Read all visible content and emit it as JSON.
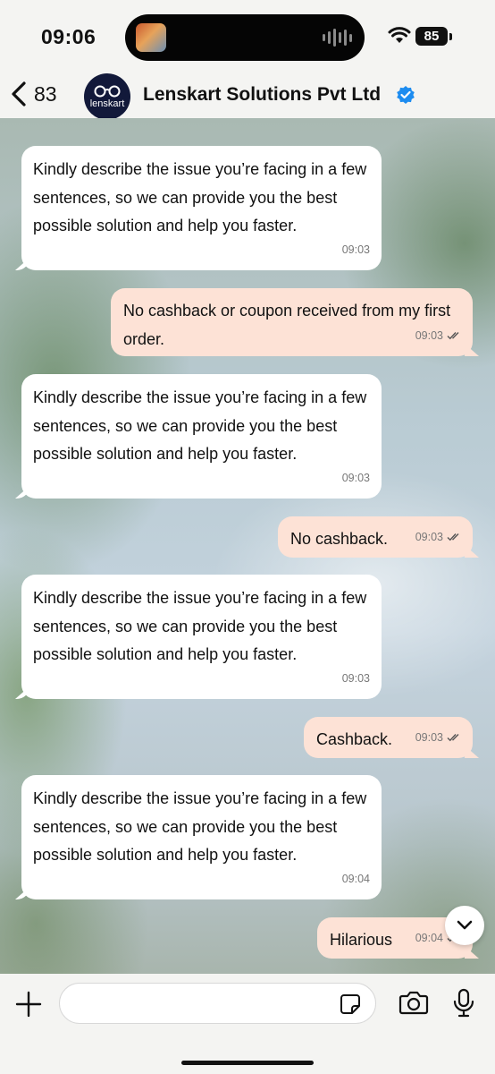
{
  "status_bar": {
    "time": "09:06",
    "battery": "85",
    "icons": [
      "dynamic-island-media-thumbnail",
      "audio-waveform-icon",
      "wifi-icon",
      "battery-icon"
    ]
  },
  "header": {
    "back_count": "83",
    "avatar_text": "lenskart",
    "contact_name": "Lenskart Solutions Pvt Ltd",
    "verified": true,
    "icons": [
      "chevron-left-icon",
      "glasses-logo-icon",
      "verified-badge-icon"
    ]
  },
  "messages": [
    {
      "direction": "in",
      "text": "Kindly describe the issue you’re facing in a few sentences, so we can provide you the best possible solution and help you faster.",
      "time": "09:03"
    },
    {
      "direction": "out",
      "text": "No cashback or coupon received from my first order.",
      "time": "09:03",
      "read": true
    },
    {
      "direction": "in",
      "text": "Kindly describe the issue you’re facing in a few sentences, so we can provide you the best possible solution and help you faster.",
      "time": "09:03"
    },
    {
      "direction": "out",
      "text": "No cashback.",
      "time": "09:03",
      "read": true
    },
    {
      "direction": "in",
      "text": "Kindly describe the issue you’re facing in a few sentences, so we can provide you the best possible solution and help you faster.",
      "time": "09:03"
    },
    {
      "direction": "out",
      "text": "Cashback.",
      "time": "09:03",
      "read": true
    },
    {
      "direction": "in",
      "text": "Kindly describe the issue you’re facing in a few sentences, so we can provide you the best possible solution and help you faster.",
      "time": "09:04"
    },
    {
      "direction": "out",
      "text": "Hilarious",
      "time": "09:04",
      "read": true
    }
  ],
  "input": {
    "placeholder": "",
    "value": "",
    "icons": [
      "plus-icon",
      "sticker-icon",
      "camera-icon",
      "microphone-icon",
      "chevron-down-icon"
    ]
  },
  "colors": {
    "incoming_bubble": "#ffffff",
    "outgoing_bubble": "#fde2d6",
    "verified_blue": "#1d8cf0",
    "avatar_bg": "#12193a",
    "read_ticks": "#555555"
  }
}
